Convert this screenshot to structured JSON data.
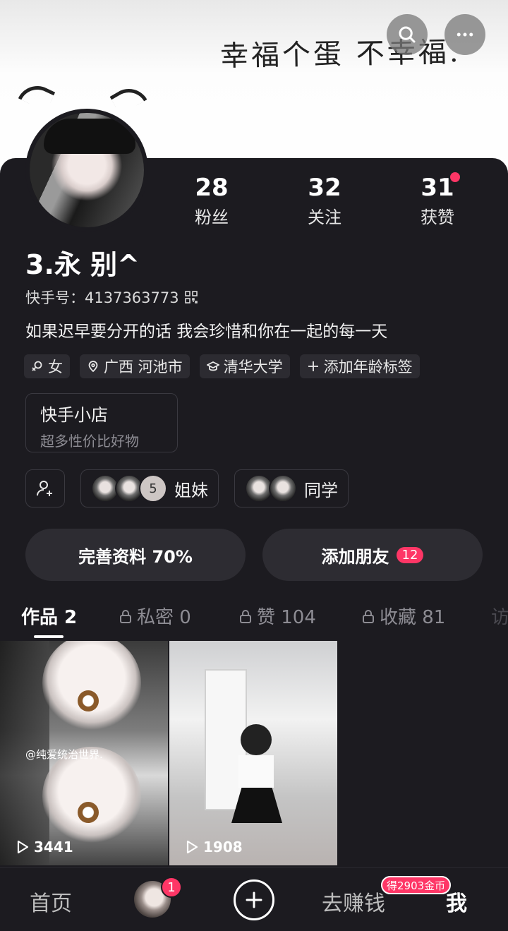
{
  "cover": {
    "text": "幸福个蛋 不幸福."
  },
  "stats": [
    {
      "value": "28",
      "label": "粉丝"
    },
    {
      "value": "32",
      "label": "关注"
    },
    {
      "value": "31",
      "label": "获赞"
    }
  ],
  "profile": {
    "username": "3.永 别^",
    "uid": "快手号：4137363773",
    "bio": "如果迟早要分开的话 我会珍惜和你在一起的每一天",
    "tags": [
      {
        "icon": "female-icon",
        "label": "女"
      },
      {
        "icon": "location-icon",
        "label": "广西 河池市"
      },
      {
        "icon": "graduation-cap-icon",
        "label": "清华大学"
      },
      {
        "icon": "plus-icon",
        "label": "添加年龄标签"
      }
    ]
  },
  "shop": {
    "title": "快手小店",
    "subtitle": "超多性价比好物"
  },
  "relations": {
    "sisters": {
      "count": "5",
      "label": "姐妹"
    },
    "classmates": {
      "label": "同学"
    }
  },
  "actions": {
    "complete_profile": "完善资料 70%",
    "add_friends": "添加朋友",
    "add_friends_badge": "12"
  },
  "tabs": [
    {
      "label": "作品 2"
    },
    {
      "label": "私密 0"
    },
    {
      "label": "赞 104"
    },
    {
      "label": "收藏 81"
    },
    {
      "label": "访"
    }
  ],
  "works": [
    {
      "plays": "3441",
      "watermark": "@纯爱统治世界."
    },
    {
      "plays": "1908"
    }
  ],
  "nav": {
    "home": "首页",
    "avatar_badge": "1",
    "earn": "去赚钱",
    "coin_badge": "得2903金币",
    "me": "我"
  },
  "colors": {
    "accent": "#fe3666",
    "background": "#1c1b20",
    "chip": "#2c2b31"
  }
}
